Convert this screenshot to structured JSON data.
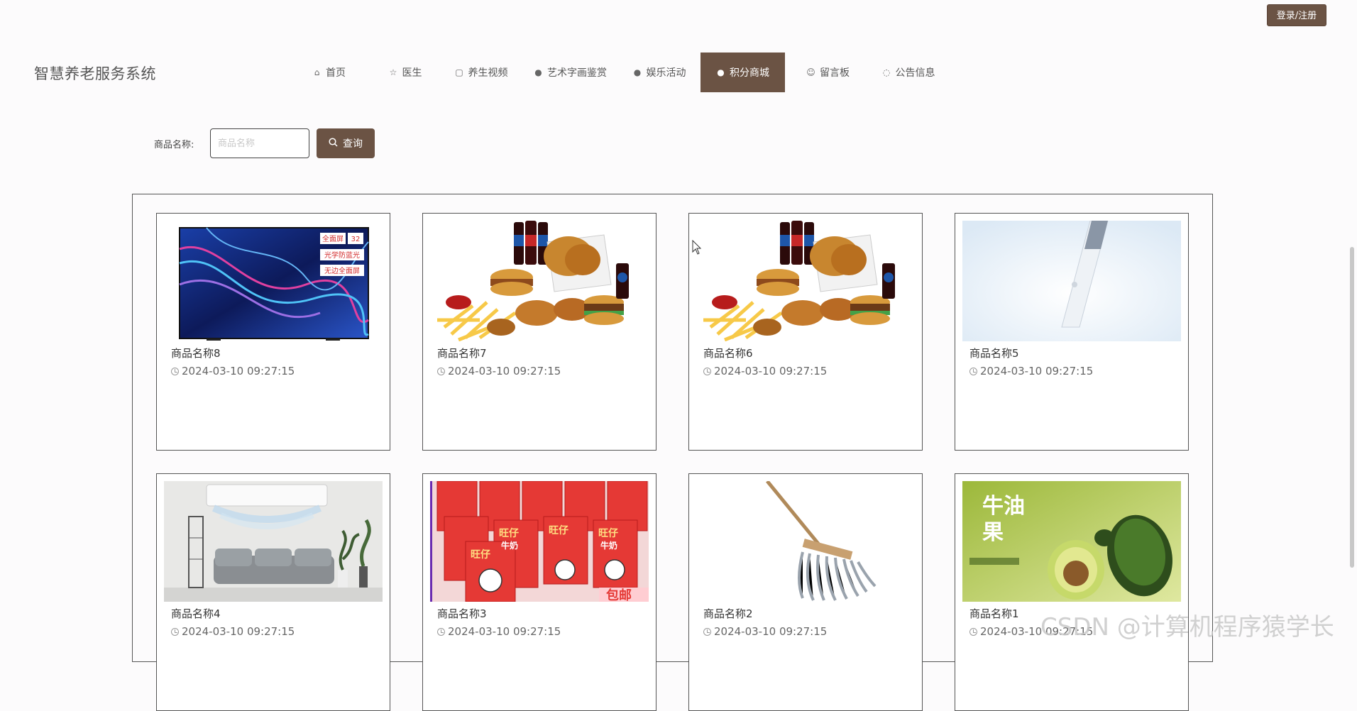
{
  "header": {
    "login_label": "登录/注册",
    "site_title": "智慧养老服务系统"
  },
  "nav": [
    {
      "label": "首页",
      "icon": "home-icon",
      "active": false
    },
    {
      "label": "医生",
      "icon": "star-icon",
      "active": false
    },
    {
      "label": "养生视频",
      "icon": "bag-icon",
      "active": false
    },
    {
      "label": "艺术字画鉴赏",
      "icon": "info-circle-icon",
      "active": false
    },
    {
      "label": "娱乐活动",
      "icon": "question-circle-icon",
      "active": false
    },
    {
      "label": "积分商城",
      "icon": "question-circle-icon",
      "active": true
    },
    {
      "label": "留言板",
      "icon": "smile-icon",
      "active": false
    },
    {
      "label": "公告信息",
      "icon": "check-circle-icon",
      "active": false
    }
  ],
  "search": {
    "label": "商品名称:",
    "placeholder": "商品名称",
    "value": "",
    "button_label": "查询"
  },
  "products": [
    {
      "name": "商品名称8",
      "time": "2024-03-10 09:27:15",
      "image": "tv"
    },
    {
      "name": "商品名称7",
      "time": "2024-03-10 09:27:15",
      "image": "fastfood"
    },
    {
      "name": "商品名称6",
      "time": "2024-03-10 09:27:15",
      "image": "fastfood"
    },
    {
      "name": "商品名称5",
      "time": "2024-03-10 09:27:15",
      "image": "pen"
    },
    {
      "name": "商品名称4",
      "time": "2024-03-10 09:27:15",
      "image": "aircon"
    },
    {
      "name": "商品名称3",
      "time": "2024-03-10 09:27:15",
      "image": "milk"
    },
    {
      "name": "商品名称2",
      "time": "2024-03-10 09:27:15",
      "image": "mop"
    },
    {
      "name": "商品名称1",
      "time": "2024-03-10 09:27:15",
      "image": "avocado"
    }
  ],
  "image_text": {
    "tv_badge_1": "全面屏",
    "tv_badge_size": "32",
    "tv_badge_2": "光学防蓝光",
    "tv_badge_3": "无边全面屏",
    "milk_brand": "旺仔",
    "milk_word": "牛奶",
    "milk_promo": "包邮",
    "avocado_title_1": "牛油",
    "avocado_title_2": "果"
  },
  "watermark": "CSDN @计算机程序猿学长"
}
